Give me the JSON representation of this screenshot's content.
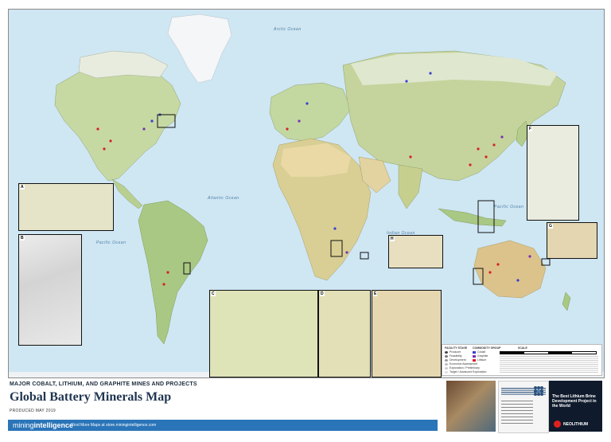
{
  "map": {
    "ocean_labels": [
      "Arctic Ocean",
      "Atlantic Ocean",
      "Pacific Ocean",
      "Indian Ocean",
      "Pacific Ocean",
      "Pacific Ocean"
    ],
    "inset_tags": [
      "A",
      "B",
      "C",
      "D",
      "E",
      "F",
      "G",
      "H"
    ],
    "commodity_colors": {
      "cobalt": "#3a3fd0",
      "graphite": "#7a2fb4",
      "lithium": "#d81f2a"
    }
  },
  "legend": {
    "facility_title": "FACILITY STAGE",
    "facility_items": [
      "Producer",
      "Feasibility",
      "Development",
      "Economic Assessment",
      "Exploration / Preliminary",
      "Target / Advanced Exploration"
    ],
    "commodity_title": "COMMODITY GROUP",
    "commodity_items": [
      "Cobalt",
      "Graphite",
      "Lithium"
    ],
    "scale_title": "SCALE"
  },
  "header": {
    "subhead": "MAJOR COBALT, LITHIUM, AND GRAPHITE MINES AND PROJECTS",
    "title": "Global Battery Minerals Map",
    "produced": "PRODUCED MAY 2019"
  },
  "footer": {
    "brand_light": "mining",
    "brand_bold": "intelligence",
    "find_more": "Find More Maps at store.miningintelligence.com"
  },
  "ads": {
    "ad3_title": "The Best Lithium Brine Development Project in the World",
    "ad3_brand": "NEOLITHIUM"
  }
}
